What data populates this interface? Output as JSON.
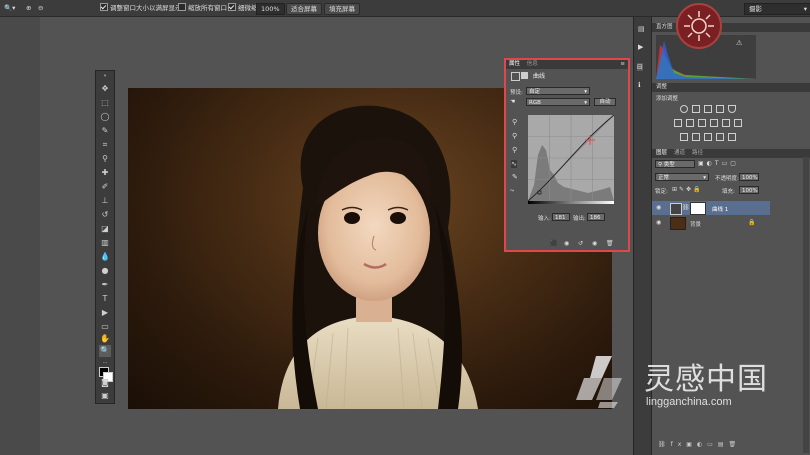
{
  "options_bar": {
    "check_resize_windows": "调整窗口大小以满屏显示",
    "check_zoom_all": "缩放所有窗口",
    "check_scrubby": "细微缩放",
    "zoom_value": "100%",
    "btn_fit_screen": "适合屏幕",
    "btn_fill_screen": "填充屏幕",
    "workspace": "摄影"
  },
  "properties": {
    "tab_properties": "属性",
    "tab_info": "信息",
    "title": "曲线",
    "preset_label": "预设:",
    "preset_value": "自定",
    "channel_value": "RGB",
    "auto_btn": "自动",
    "input_label": "输入:",
    "input_value": "181",
    "output_label": "输出:",
    "output_value": "186"
  },
  "histogram": {
    "tab": "直方图"
  },
  "adjustments": {
    "tab": "调整",
    "add_label": "添加调整"
  },
  "layers": {
    "tab_layers": "图层",
    "tab_channels": "通道",
    "tab_paths": "路径",
    "kind_filter": "类型",
    "blend_mode": "正常",
    "opacity_label": "不透明度:",
    "opacity_value": "100%",
    "lock_label": "锁定:",
    "fill_label": "填充:",
    "fill_value": "100%",
    "items": [
      {
        "name": "曲线 1"
      },
      {
        "name": "背景"
      }
    ]
  },
  "watermark": {
    "brand_cn": "灵感中国",
    "domain": "lingganchina.com"
  },
  "colors": {
    "accent_highlight": "#e0474c",
    "selected_layer": "#5a6f8f"
  }
}
